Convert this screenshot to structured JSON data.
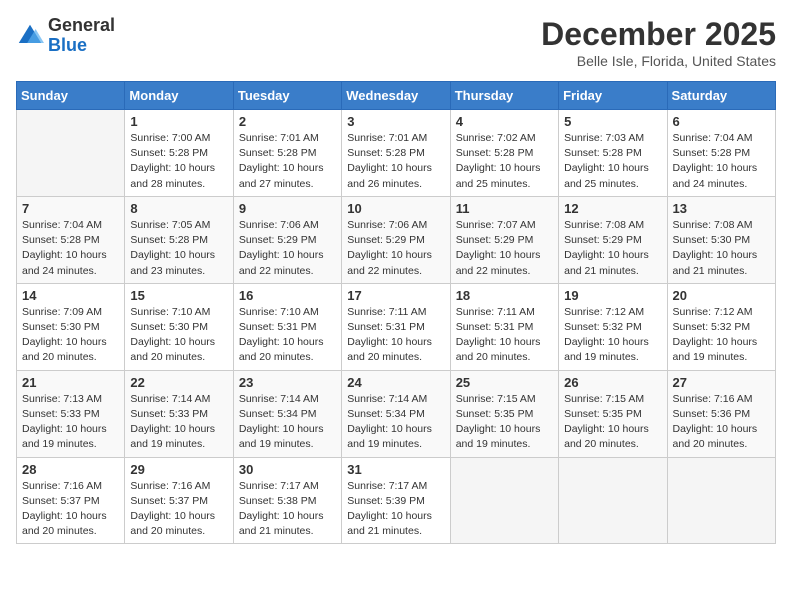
{
  "header": {
    "logo_general": "General",
    "logo_blue": "Blue",
    "month_title": "December 2025",
    "location": "Belle Isle, Florida, United States"
  },
  "days_of_week": [
    "Sunday",
    "Monday",
    "Tuesday",
    "Wednesday",
    "Thursday",
    "Friday",
    "Saturday"
  ],
  "weeks": [
    [
      {
        "day": "",
        "sunrise": "",
        "sunset": "",
        "daylight": ""
      },
      {
        "day": "1",
        "sunrise": "Sunrise: 7:00 AM",
        "sunset": "Sunset: 5:28 PM",
        "daylight": "Daylight: 10 hours and 28 minutes."
      },
      {
        "day": "2",
        "sunrise": "Sunrise: 7:01 AM",
        "sunset": "Sunset: 5:28 PM",
        "daylight": "Daylight: 10 hours and 27 minutes."
      },
      {
        "day": "3",
        "sunrise": "Sunrise: 7:01 AM",
        "sunset": "Sunset: 5:28 PM",
        "daylight": "Daylight: 10 hours and 26 minutes."
      },
      {
        "day": "4",
        "sunrise": "Sunrise: 7:02 AM",
        "sunset": "Sunset: 5:28 PM",
        "daylight": "Daylight: 10 hours and 25 minutes."
      },
      {
        "day": "5",
        "sunrise": "Sunrise: 7:03 AM",
        "sunset": "Sunset: 5:28 PM",
        "daylight": "Daylight: 10 hours and 25 minutes."
      },
      {
        "day": "6",
        "sunrise": "Sunrise: 7:04 AM",
        "sunset": "Sunset: 5:28 PM",
        "daylight": "Daylight: 10 hours and 24 minutes."
      }
    ],
    [
      {
        "day": "7",
        "sunrise": "Sunrise: 7:04 AM",
        "sunset": "Sunset: 5:28 PM",
        "daylight": "Daylight: 10 hours and 24 minutes."
      },
      {
        "day": "8",
        "sunrise": "Sunrise: 7:05 AM",
        "sunset": "Sunset: 5:28 PM",
        "daylight": "Daylight: 10 hours and 23 minutes."
      },
      {
        "day": "9",
        "sunrise": "Sunrise: 7:06 AM",
        "sunset": "Sunset: 5:29 PM",
        "daylight": "Daylight: 10 hours and 22 minutes."
      },
      {
        "day": "10",
        "sunrise": "Sunrise: 7:06 AM",
        "sunset": "Sunset: 5:29 PM",
        "daylight": "Daylight: 10 hours and 22 minutes."
      },
      {
        "day": "11",
        "sunrise": "Sunrise: 7:07 AM",
        "sunset": "Sunset: 5:29 PM",
        "daylight": "Daylight: 10 hours and 22 minutes."
      },
      {
        "day": "12",
        "sunrise": "Sunrise: 7:08 AM",
        "sunset": "Sunset: 5:29 PM",
        "daylight": "Daylight: 10 hours and 21 minutes."
      },
      {
        "day": "13",
        "sunrise": "Sunrise: 7:08 AM",
        "sunset": "Sunset: 5:30 PM",
        "daylight": "Daylight: 10 hours and 21 minutes."
      }
    ],
    [
      {
        "day": "14",
        "sunrise": "Sunrise: 7:09 AM",
        "sunset": "Sunset: 5:30 PM",
        "daylight": "Daylight: 10 hours and 20 minutes."
      },
      {
        "day": "15",
        "sunrise": "Sunrise: 7:10 AM",
        "sunset": "Sunset: 5:30 PM",
        "daylight": "Daylight: 10 hours and 20 minutes."
      },
      {
        "day": "16",
        "sunrise": "Sunrise: 7:10 AM",
        "sunset": "Sunset: 5:31 PM",
        "daylight": "Daylight: 10 hours and 20 minutes."
      },
      {
        "day": "17",
        "sunrise": "Sunrise: 7:11 AM",
        "sunset": "Sunset: 5:31 PM",
        "daylight": "Daylight: 10 hours and 20 minutes."
      },
      {
        "day": "18",
        "sunrise": "Sunrise: 7:11 AM",
        "sunset": "Sunset: 5:31 PM",
        "daylight": "Daylight: 10 hours and 20 minutes."
      },
      {
        "day": "19",
        "sunrise": "Sunrise: 7:12 AM",
        "sunset": "Sunset: 5:32 PM",
        "daylight": "Daylight: 10 hours and 19 minutes."
      },
      {
        "day": "20",
        "sunrise": "Sunrise: 7:12 AM",
        "sunset": "Sunset: 5:32 PM",
        "daylight": "Daylight: 10 hours and 19 minutes."
      }
    ],
    [
      {
        "day": "21",
        "sunrise": "Sunrise: 7:13 AM",
        "sunset": "Sunset: 5:33 PM",
        "daylight": "Daylight: 10 hours and 19 minutes."
      },
      {
        "day": "22",
        "sunrise": "Sunrise: 7:14 AM",
        "sunset": "Sunset: 5:33 PM",
        "daylight": "Daylight: 10 hours and 19 minutes."
      },
      {
        "day": "23",
        "sunrise": "Sunrise: 7:14 AM",
        "sunset": "Sunset: 5:34 PM",
        "daylight": "Daylight: 10 hours and 19 minutes."
      },
      {
        "day": "24",
        "sunrise": "Sunrise: 7:14 AM",
        "sunset": "Sunset: 5:34 PM",
        "daylight": "Daylight: 10 hours and 19 minutes."
      },
      {
        "day": "25",
        "sunrise": "Sunrise: 7:15 AM",
        "sunset": "Sunset: 5:35 PM",
        "daylight": "Daylight: 10 hours and 19 minutes."
      },
      {
        "day": "26",
        "sunrise": "Sunrise: 7:15 AM",
        "sunset": "Sunset: 5:35 PM",
        "daylight": "Daylight: 10 hours and 20 minutes."
      },
      {
        "day": "27",
        "sunrise": "Sunrise: 7:16 AM",
        "sunset": "Sunset: 5:36 PM",
        "daylight": "Daylight: 10 hours and 20 minutes."
      }
    ],
    [
      {
        "day": "28",
        "sunrise": "Sunrise: 7:16 AM",
        "sunset": "Sunset: 5:37 PM",
        "daylight": "Daylight: 10 hours and 20 minutes."
      },
      {
        "day": "29",
        "sunrise": "Sunrise: 7:16 AM",
        "sunset": "Sunset: 5:37 PM",
        "daylight": "Daylight: 10 hours and 20 minutes."
      },
      {
        "day": "30",
        "sunrise": "Sunrise: 7:17 AM",
        "sunset": "Sunset: 5:38 PM",
        "daylight": "Daylight: 10 hours and 21 minutes."
      },
      {
        "day": "31",
        "sunrise": "Sunrise: 7:17 AM",
        "sunset": "Sunset: 5:39 PM",
        "daylight": "Daylight: 10 hours and 21 minutes."
      },
      {
        "day": "",
        "sunrise": "",
        "sunset": "",
        "daylight": ""
      },
      {
        "day": "",
        "sunrise": "",
        "sunset": "",
        "daylight": ""
      },
      {
        "day": "",
        "sunrise": "",
        "sunset": "",
        "daylight": ""
      }
    ]
  ]
}
